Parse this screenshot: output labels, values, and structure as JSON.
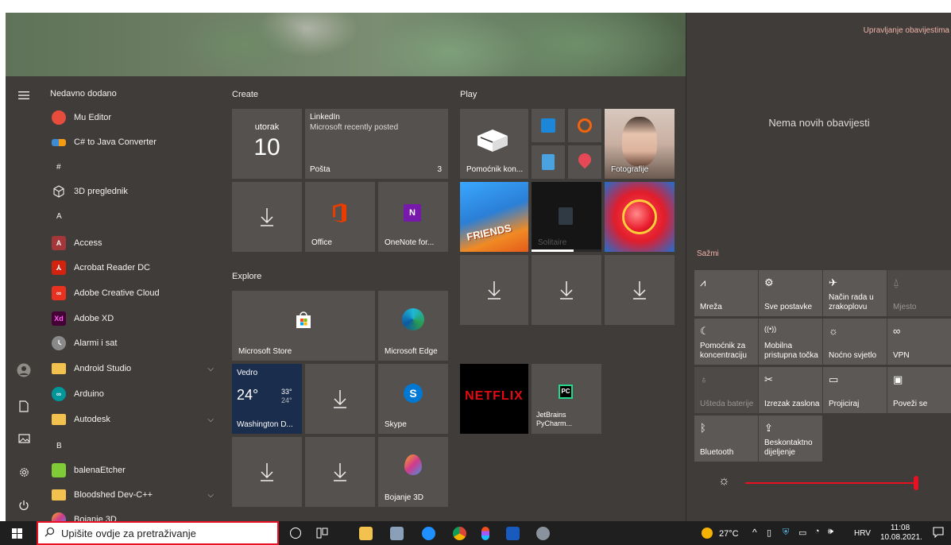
{
  "start_menu": {
    "rail_icons": [
      "hamburger-icon",
      "user-avatar-icon",
      "document-icon",
      "pictures-icon",
      "settings-icon",
      "power-icon"
    ],
    "recently_added_label": "Nedavno dodano",
    "apps": [
      {
        "type": "app",
        "label": "Mu Editor",
        "icon": "mu-editor-icon",
        "color": "#e74c3c"
      },
      {
        "type": "app",
        "label": "C# to Java Converter",
        "icon": "converter-icon",
        "color": "#3d8bd4"
      },
      {
        "type": "header",
        "label": "#"
      },
      {
        "type": "app",
        "label": "3D preglednik",
        "icon": "cube-icon",
        "color": "#403c39"
      },
      {
        "type": "header",
        "label": "A"
      },
      {
        "type": "app",
        "label": "Access",
        "icon": "access-icon",
        "color": "#a4373a"
      },
      {
        "type": "app",
        "label": "Acrobat Reader DC",
        "icon": "acrobat-icon",
        "color": "#d3230e"
      },
      {
        "type": "app",
        "label": "Adobe Creative Cloud",
        "icon": "creative-cloud-icon",
        "color": "#e8311e"
      },
      {
        "type": "app",
        "label": "Adobe XD",
        "icon": "adobe-xd-icon",
        "color": "#450135"
      },
      {
        "type": "app",
        "label": "Alarmi i sat",
        "icon": "clock-icon",
        "color": "#8a8a8a"
      },
      {
        "type": "folder",
        "label": "Android Studio",
        "icon": "folder-icon",
        "color": "#f2c14e"
      },
      {
        "type": "app",
        "label": "Arduino",
        "icon": "arduino-icon",
        "color": "#00979c"
      },
      {
        "type": "folder",
        "label": "Autodesk",
        "icon": "folder-icon",
        "color": "#f2c14e"
      },
      {
        "type": "header",
        "label": "B"
      },
      {
        "type": "app",
        "label": "balenaEtcher",
        "icon": "balena-etcher-icon",
        "color": "#7fcc36"
      },
      {
        "type": "folder",
        "label": "Bloodshed Dev-C++",
        "icon": "folder-icon",
        "color": "#f2c14e"
      },
      {
        "type": "app",
        "label": "Bojanje 3D",
        "icon": "paint3d-icon",
        "color": "#d03a8c"
      }
    ],
    "groups": {
      "create": "Create",
      "play": "Play",
      "explore": "Explore"
    },
    "tiles": {
      "calendar": {
        "day": "utorak",
        "date": "10"
      },
      "mail": {
        "sender": "LinkedIn",
        "message": "Microsoft recently posted",
        "label": "Pošta",
        "count": "3"
      },
      "office": "Office",
      "onenote": "OneNote for...",
      "pomocnik": "Pomoćnik kon...",
      "fotografije": "Fotografije",
      "solitaire": "Solitaire",
      "store": "Microsoft Store",
      "edge": "Microsoft Edge",
      "weather": {
        "condition": "Vedro",
        "temp": "24°",
        "high": "33°",
        "low": "24°",
        "location": "Washington D..."
      },
      "skype": "Skype",
      "netflix": "NETFLIX",
      "pycharm": "JetBrains PyCharm...",
      "bojanje": "Bojanje 3D"
    }
  },
  "action_center": {
    "manage_link": "Upravljanje obavijestima",
    "no_notifications": "Nema novih obavijesti",
    "collapse": "Sažmi",
    "quick_actions": [
      {
        "label": "Mreža",
        "icon": "network-icon",
        "dim": false
      },
      {
        "label": "Sve postavke",
        "icon": "settings-icon",
        "dim": false
      },
      {
        "label": "Način rada u zrakoplovu",
        "icon": "airplane-icon",
        "dim": false
      },
      {
        "label": "Mjesto",
        "icon": "location-icon",
        "dim": true
      },
      {
        "label": "Pomoćnik za koncentraciju",
        "icon": "moon-icon",
        "dim": false
      },
      {
        "label": "Mobilna pristupna točka",
        "icon": "hotspot-icon",
        "dim": false
      },
      {
        "label": "Noćno svjetlo",
        "icon": "sun-icon",
        "dim": false
      },
      {
        "label": "VPN",
        "icon": "vpn-icon",
        "dim": false
      },
      {
        "label": "Ušteda baterije",
        "icon": "battery-saver-icon",
        "dim": true
      },
      {
        "label": "Izrezak zaslona",
        "icon": "snip-icon",
        "dim": false
      },
      {
        "label": "Projiciraj",
        "icon": "project-icon",
        "dim": false
      },
      {
        "label": "Poveži se",
        "icon": "connect-icon",
        "dim": false
      },
      {
        "label": "Bluetooth",
        "icon": "bluetooth-icon",
        "dim": false
      },
      {
        "label": "Beskontaktno dijeljenje",
        "icon": "share-icon",
        "dim": false
      }
    ],
    "brightness": 1.0,
    "brightness_color": "#e81123"
  },
  "taskbar": {
    "search_placeholder": "Upišite ovdje za pretraživanje",
    "weather": "27°C",
    "language": "HRV",
    "time": "11:08",
    "date": "10.08.2021."
  }
}
